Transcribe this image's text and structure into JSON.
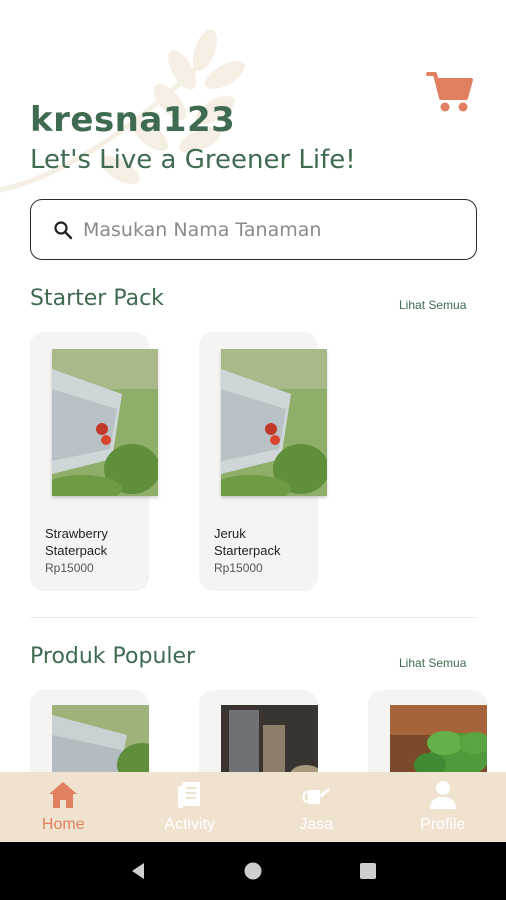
{
  "header": {
    "username": "kresna123",
    "tagline": "Let's Live a Greener Life!"
  },
  "search": {
    "placeholder": "Masukan Nama Tanaman",
    "value": ""
  },
  "starter_pack": {
    "title": "Starter Pack",
    "see_all": "Lihat Semua",
    "items": [
      {
        "name": "Strawberry Staterpack",
        "price": "Rp15000",
        "image": "strawberry-plant"
      },
      {
        "name": "Jeruk Starterpack",
        "price": "Rp15000",
        "image": "strawberry-plant"
      }
    ]
  },
  "popular": {
    "title": "Produk Populer",
    "see_all": "Lihat Semua",
    "items": [
      {
        "image": "strawberry-plant"
      },
      {
        "image": "soil-and-tools"
      },
      {
        "image": "basil-leaves"
      }
    ]
  },
  "bottom_nav": {
    "items": [
      {
        "label": "Home",
        "icon": "home-icon",
        "active": true
      },
      {
        "label": "Activity",
        "icon": "document-icon",
        "active": false
      },
      {
        "label": "Jasa",
        "icon": "watering-can-icon",
        "active": false
      },
      {
        "label": "Profile",
        "icon": "person-icon",
        "active": false
      }
    ]
  },
  "colors": {
    "brand_green": "#3f6b50",
    "accent_orange": "#e08061",
    "nav_bg": "#efe2cf",
    "card_bg": "#f4f4f2"
  }
}
